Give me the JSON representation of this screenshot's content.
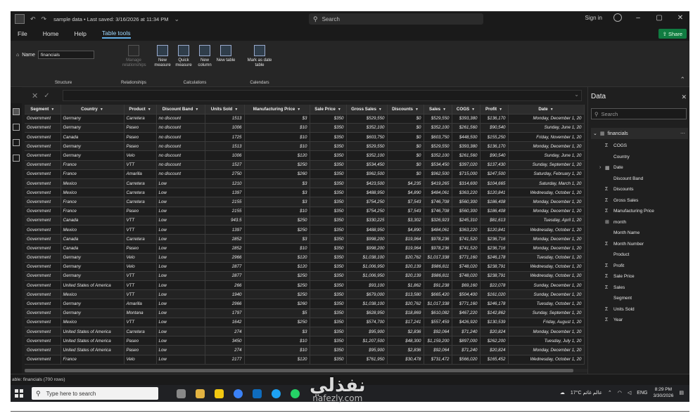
{
  "titlebar": {
    "title": "sample data • Last saved: 3/16/2026 at 11:34 PM",
    "search_placeholder": "Search",
    "sign_in": "Sign in"
  },
  "menu": {
    "file": "File",
    "home": "Home",
    "help": "Help",
    "table_tools": "Table tools",
    "share": "Share"
  },
  "ribbon": {
    "name_label": "Name",
    "name_value": "financials",
    "structure_label": "Structure",
    "manage_relationships": "Manage relationships",
    "relationships_label": "Relationships",
    "new_measure": "New measure",
    "quick_measure": "Quick measure",
    "new_column": "New column",
    "new_table": "New table",
    "calculations_label": "Calculations",
    "mark_as_date_table": "Mark as date table",
    "calendars_label": "Calendars"
  },
  "table": {
    "columns": [
      "Segment",
      "Country",
      "Product",
      "Discount Band",
      "Units Sold",
      "Manufacturing Price",
      "Sale Price",
      "Gross Sales",
      "Discounts",
      "Sales",
      "COGS",
      "Profit",
      "Date"
    ],
    "rows": [
      [
        "Government",
        "Germany",
        "Carretera",
        "no discount",
        "1513",
        "$3",
        "$350",
        "$529,550",
        "$0",
        "$529,550",
        "$393,380",
        "$136,170",
        "Monday, December 1, 20"
      ],
      [
        "Government",
        "Germany",
        "Paseo",
        "no discount",
        "1006",
        "$10",
        "$350",
        "$352,100",
        "$0",
        "$352,100",
        "$261,560",
        "$90,540",
        "Sunday, June 1, 20"
      ],
      [
        "Government",
        "Canada",
        "Paseo",
        "no discount",
        "1725",
        "$10",
        "$350",
        "$603,750",
        "$0",
        "$603,750",
        "$448,500",
        "$155,250",
        "Friday, November 1, 20"
      ],
      [
        "Government",
        "Germany",
        "Paseo",
        "no discount",
        "1513",
        "$10",
        "$350",
        "$529,550",
        "$0",
        "$529,550",
        "$393,380",
        "$136,170",
        "Monday, December 1, 20"
      ],
      [
        "Government",
        "Germany",
        "Velo",
        "no discount",
        "1006",
        "$120",
        "$350",
        "$352,100",
        "$0",
        "$352,100",
        "$261,560",
        "$90,540",
        "Sunday, June 1, 20"
      ],
      [
        "Government",
        "France",
        "VTT",
        "no discount",
        "1527",
        "$250",
        "$350",
        "$534,450",
        "$0",
        "$534,450",
        "$397,020",
        "$137,430",
        "Sunday, September 1, 20"
      ],
      [
        "Government",
        "France",
        "Amarilla",
        "no discount",
        "2750",
        "$260",
        "$350",
        "$962,500",
        "$0",
        "$962,500",
        "$715,000",
        "$247,500",
        "Saturday, February 1, 20"
      ],
      [
        "Government",
        "Mexico",
        "Carretera",
        "Low",
        "1210",
        "$3",
        "$350",
        "$423,500",
        "$4,235",
        "$419,265",
        "$314,600",
        "$104,665",
        "Saturday, March 1, 20"
      ],
      [
        "Government",
        "Mexico",
        "Carretera",
        "Low",
        "1397",
        "$3",
        "$350",
        "$488,950",
        "$4,890",
        "$484,061",
        "$363,220",
        "$120,841",
        "Wednesday, October 1, 20"
      ],
      [
        "Government",
        "France",
        "Carretera",
        "Low",
        "2155",
        "$3",
        "$350",
        "$754,250",
        "$7,543",
        "$746,708",
        "$560,300",
        "$186,408",
        "Monday, December 1, 20"
      ],
      [
        "Government",
        "France",
        "Paseo",
        "Low",
        "2155",
        "$10",
        "$350",
        "$754,250",
        "$7,543",
        "$746,708",
        "$560,300",
        "$186,408",
        "Monday, December 1, 20"
      ],
      [
        "Government",
        "Canada",
        "VTT",
        "Low",
        "943.5",
        "$250",
        "$350",
        "$330,225",
        "$3,302",
        "$326,923",
        "$245,310",
        "$81,613",
        "Tuesday, April 1, 20"
      ],
      [
        "Government",
        "Mexico",
        "VTT",
        "Low",
        "1397",
        "$250",
        "$350",
        "$488,950",
        "$4,890",
        "$484,061",
        "$363,220",
        "$120,841",
        "Wednesday, October 1, 20"
      ],
      [
        "Government",
        "Canada",
        "Carretera",
        "Low",
        "2852",
        "$3",
        "$350",
        "$998,200",
        "$19,964",
        "$978,236",
        "$741,520",
        "$236,716",
        "Monday, December 1, 20"
      ],
      [
        "Government",
        "Canada",
        "Paseo",
        "Low",
        "2852",
        "$10",
        "$350",
        "$998,200",
        "$19,964",
        "$978,236",
        "$741,520",
        "$236,716",
        "Monday, December 1, 20"
      ],
      [
        "Government",
        "Germany",
        "Velo",
        "Low",
        "2966",
        "$120",
        "$350",
        "$1,038,100",
        "$20,762",
        "$1,017,338",
        "$771,160",
        "$246,178",
        "Tuesday, October 1, 20"
      ],
      [
        "Government",
        "Germany",
        "Velo",
        "Low",
        "2877",
        "$120",
        "$350",
        "$1,006,950",
        "$20,139",
        "$986,811",
        "$748,020",
        "$238,791",
        "Wednesday, October 1, 20"
      ],
      [
        "Government",
        "Germany",
        "VTT",
        "Low",
        "2877",
        "$250",
        "$350",
        "$1,006,950",
        "$20,139",
        "$986,811",
        "$748,020",
        "$238,791",
        "Wednesday, October 1, 20"
      ],
      [
        "Government",
        "United States of America",
        "VTT",
        "Low",
        "266",
        "$250",
        "$350",
        "$93,100",
        "$1,862",
        "$91,238",
        "$69,160",
        "$22,078",
        "Sunday, December 1, 20"
      ],
      [
        "Government",
        "Mexico",
        "VTT",
        "Low",
        "1940",
        "$250",
        "$350",
        "$679,000",
        "$13,580",
        "$665,420",
        "$504,400",
        "$161,020",
        "Sunday, December 1, 20"
      ],
      [
        "Government",
        "Germany",
        "Amarilla",
        "Low",
        "2966",
        "$260",
        "$350",
        "$1,038,100",
        "$20,762",
        "$1,017,338",
        "$771,160",
        "$246,178",
        "Tuesday, October 1, 20"
      ],
      [
        "Government",
        "Germany",
        "Montana",
        "Low",
        "1797",
        "$5",
        "$350",
        "$628,950",
        "$18,869",
        "$610,082",
        "$467,220",
        "$142,862",
        "Sunday, September 1, 20"
      ],
      [
        "Government",
        "Mexico",
        "VTT",
        "Low",
        "1642",
        "$250",
        "$350",
        "$574,700",
        "$17,241",
        "$557,459",
        "$426,920",
        "$130,539",
        "Friday, August 1, 20"
      ],
      [
        "Government",
        "United States of America",
        "Carretera",
        "Low",
        "274",
        "$3",
        "$350",
        "$95,900",
        "$2,836",
        "$92,064",
        "$71,240",
        "$20,824",
        "Monday, December 1, 20"
      ],
      [
        "Government",
        "United States of America",
        "Paseo",
        "Low",
        "3450",
        "$10",
        "$350",
        "$1,207,500",
        "$48,300",
        "$1,159,200",
        "$897,000",
        "$262,200",
        "Tuesday, July 1, 20"
      ],
      [
        "Government",
        "United States of America",
        "Paseo",
        "Low",
        "274",
        "$10",
        "$350",
        "$95,900",
        "$2,836",
        "$92,064",
        "$71,240",
        "$20,824",
        "Monday, December 1, 20"
      ],
      [
        "Government",
        "France",
        "Velo",
        "Low",
        "2177",
        "$120",
        "$350",
        "$761,950",
        "$30,478",
        "$731,472",
        "$566,020",
        "$165,452",
        "Wednesday, October 1, 20"
      ]
    ]
  },
  "status": {
    "text": "able: financials (700 rows)"
  },
  "data_pane": {
    "title": "Data",
    "search_placeholder": "Search",
    "table_name": "financials",
    "fields": [
      {
        "icon": "sigma",
        "label": "COGS"
      },
      {
        "icon": "none",
        "label": "Country"
      },
      {
        "icon": "calendar",
        "label": "Date"
      },
      {
        "icon": "none",
        "label": "Discount Band"
      },
      {
        "icon": "sigma",
        "label": "Discounts"
      },
      {
        "icon": "sigma",
        "label": "Gross Sales"
      },
      {
        "icon": "sigma",
        "label": "Manufacturing Price"
      },
      {
        "icon": "calc",
        "label": "month"
      },
      {
        "icon": "none",
        "label": "Month Name"
      },
      {
        "icon": "sigma",
        "label": "Month Number"
      },
      {
        "icon": "none",
        "label": "Product"
      },
      {
        "icon": "sigma",
        "label": "Profit"
      },
      {
        "icon": "sigma",
        "label": "Sale Price"
      },
      {
        "icon": "sigma",
        "label": "Sales"
      },
      {
        "icon": "none",
        "label": "Segment"
      },
      {
        "icon": "sigma",
        "label": "Units Sold"
      },
      {
        "icon": "sigma",
        "label": "Year"
      }
    ]
  },
  "taskbar": {
    "search_placeholder": "Type here to search",
    "weather": "17°C عالم غائم",
    "lang": "ENG",
    "time": "8:29 PM",
    "date": "3/30/2026"
  },
  "watermark": {
    "text": "نفذلي",
    "sub": "nafezly.com"
  },
  "colors": {
    "app_bg": "#1f1f1f",
    "accent": "#64b0e8",
    "share": "#107c41"
  }
}
